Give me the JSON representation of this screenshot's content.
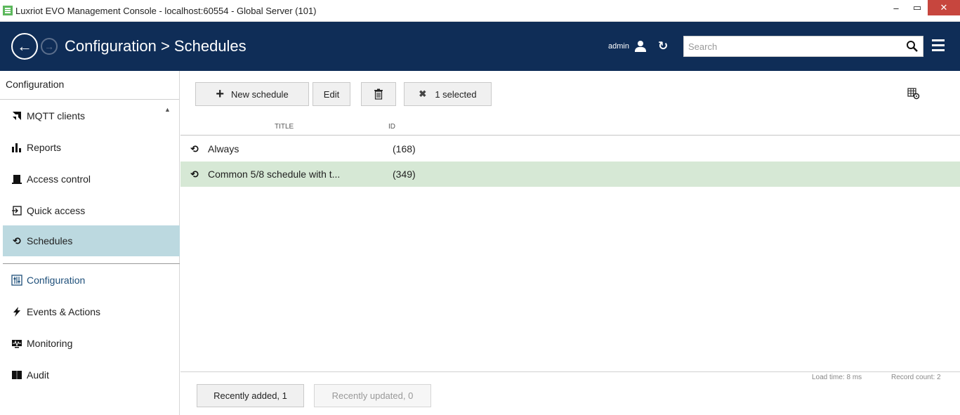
{
  "window": {
    "title": "Luxriot EVO Management Console - localhost:60554 - Global Server (101)",
    "minimize": "‒",
    "maximize": "▭",
    "close": "✕"
  },
  "header": {
    "breadcrumb": "Configuration > Schedules",
    "user": "admin",
    "search_placeholder": "Search"
  },
  "sidebar": {
    "header": "Configuration",
    "items": [
      {
        "label": "MQTT clients",
        "icon": "rss-icon"
      },
      {
        "label": "Reports",
        "icon": "bar-chart-icon"
      },
      {
        "label": "Access control",
        "icon": "door-icon"
      },
      {
        "label": "Quick access",
        "icon": "quick-access-icon"
      },
      {
        "label": "Schedules",
        "icon": "schedule-icon"
      }
    ],
    "sections": [
      {
        "label": "Configuration",
        "icon": "configuration-icon"
      },
      {
        "label": "Events & Actions",
        "icon": "lightning-icon"
      },
      {
        "label": "Monitoring",
        "icon": "monitoring-icon"
      },
      {
        "label": "Audit",
        "icon": "book-icon"
      }
    ]
  },
  "toolbar": {
    "new_label": "New schedule",
    "edit_label": "Edit",
    "selected_label": "1 selected"
  },
  "table": {
    "columns": [
      "TITLE",
      "ID"
    ],
    "rows": [
      {
        "title": "Always",
        "id": "(168)",
        "selected": false
      },
      {
        "title": "Common 5/8 schedule with t...",
        "id": "(349)",
        "selected": true
      }
    ]
  },
  "status": {
    "load_time": "Load time: 8 ms",
    "record_count": "Record count: 2"
  },
  "footer": {
    "recently_added": "Recently added, 1",
    "recently_updated": "Recently updated, 0"
  },
  "colors": {
    "header_bg": "#0f2d57",
    "active_sidebar": "#bcd9e0",
    "selected_row": "#d6e8d5",
    "close_button": "#c7463e"
  }
}
